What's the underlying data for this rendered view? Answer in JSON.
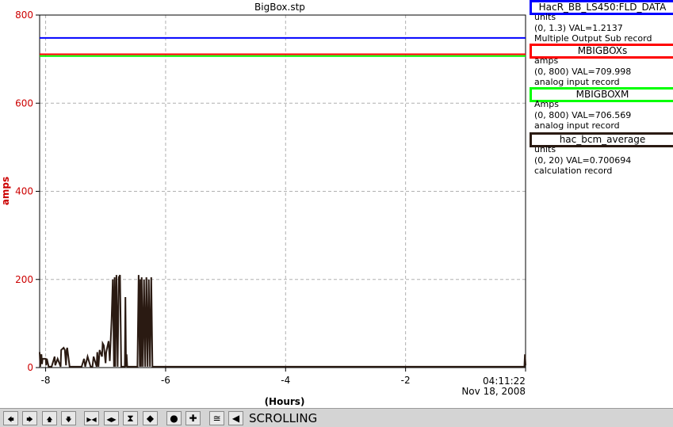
{
  "chart_data": {
    "type": "line",
    "title": "BigBox.stp",
    "xlabel": "(Hours)",
    "ylabel": "amps",
    "xlim": [
      -8.1,
      0
    ],
    "ylim": [
      0,
      800
    ],
    "x_ticks": [
      -8,
      -6,
      -4,
      -2
    ],
    "x_tick_labels": [
      "-8",
      "-6",
      "-4",
      "-2"
    ],
    "y_ticks": [
      0,
      200,
      400,
      600,
      800
    ],
    "y_tick_labels": [
      "0",
      "200",
      "400",
      "600",
      "800"
    ],
    "end_time": "04:11:22",
    "end_date": "Nov 18, 2008",
    "grid": true,
    "series": [
      {
        "name": "HacR_BB_LS450:FLD_DATA",
        "color": "#0000ff",
        "x": [
          -8.1,
          0
        ],
        "y": [
          748,
          748
        ]
      },
      {
        "name": "MBIGBOXs",
        "color": "#ff0000",
        "x": [
          -8.1,
          0
        ],
        "y": [
          711,
          711
        ]
      },
      {
        "name": "MBIGBOXM",
        "color": "#00ff00",
        "x": [
          -8.1,
          0
        ],
        "y": [
          707,
          707
        ]
      },
      {
        "name": "hac_bcm_average",
        "color": "#2a1a12",
        "x": [
          -8.1,
          -8.09,
          -8.08,
          -8.07,
          -8.06,
          -8.05,
          -8.0,
          -7.99,
          -7.98,
          -7.95,
          -7.9,
          -7.85,
          -7.84,
          -7.8,
          -7.75,
          -7.74,
          -7.7,
          -7.68,
          -7.66,
          -7.65,
          -7.64,
          -7.6,
          -7.5,
          -7.4,
          -7.36,
          -7.34,
          -7.3,
          -7.28,
          -7.25,
          -7.22,
          -7.2,
          -7.15,
          -7.14,
          -7.12,
          -7.1,
          -7.06,
          -7.05,
          -7.03,
          -7.0,
          -6.99,
          -6.95,
          -6.93,
          -6.9,
          -6.88,
          -6.86,
          -6.85,
          -6.84,
          -6.82,
          -6.8,
          -6.78,
          -6.76,
          -6.74,
          -6.72,
          -6.7,
          -6.68,
          -6.67,
          -6.66,
          -6.65,
          -6.64,
          -6.6,
          -6.58,
          -6.55,
          -6.52,
          -6.5,
          -6.47,
          -6.45,
          -6.43,
          -6.42,
          -6.41,
          -6.4,
          -6.38,
          -6.36,
          -6.34,
          -6.32,
          -6.3,
          -6.28,
          -6.26,
          -6.24,
          -6.22,
          -6.2,
          -6.18,
          -6.16,
          -6.14,
          -6.12,
          -6.1,
          -6.08,
          -5.0,
          -4.0,
          -3.0,
          -2.0,
          -1.0,
          -0.02,
          -0.01,
          0.0
        ],
        "y": [
          35,
          2,
          25,
          30,
          8,
          20,
          20,
          5,
          20,
          2,
          2,
          25,
          5,
          20,
          2,
          40,
          45,
          40,
          5,
          40,
          45,
          2,
          2,
          2,
          20,
          2,
          25,
          15,
          2,
          2,
          25,
          2,
          35,
          2,
          40,
          25,
          55,
          50,
          10,
          35,
          60,
          15,
          110,
          200,
          2,
          205,
          2,
          210,
          2,
          205,
          210,
          2,
          2,
          2,
          2,
          160,
          2,
          30,
          2,
          2,
          2,
          2,
          2,
          2,
          2,
          210,
          2,
          200,
          2,
          205,
          2,
          200,
          2,
          205,
          2,
          200,
          2,
          205,
          2,
          2,
          2,
          2,
          2,
          2,
          2,
          2,
          2,
          2,
          2,
          2,
          2,
          2,
          30,
          5
        ]
      }
    ]
  },
  "legend": [
    {
      "name": "HacR_BB_LS450:FLD_DATA",
      "color": "#0000ff",
      "units": "units",
      "range_val": "(0, 1.3) VAL=1.2137",
      "record": "Multiple Output Sub record"
    },
    {
      "name": "MBIGBOXs",
      "color": "#ff0000",
      "units": "amps",
      "range_val": "(0, 800) VAL=709.998",
      "record": "analog input record"
    },
    {
      "name": "MBIGBOXM",
      "color": "#00ff00",
      "units": "Amps",
      "range_val": "(0, 800) VAL=706.569",
      "record": "analog input record"
    },
    {
      "name": "hac_bcm_average",
      "color": "#2a1a12",
      "units": "units",
      "range_val": "(0, 20) VAL=0.700694",
      "record": "calculation record"
    }
  ],
  "toolbar": {
    "status": "SCROLLING",
    "buttons": [
      {
        "name": "scroll-left-button",
        "glyph": "🡄"
      },
      {
        "name": "scroll-right-button",
        "glyph": "🡆"
      },
      {
        "name": "scroll-up-button",
        "glyph": "🡅"
      },
      {
        "name": "scroll-down-button",
        "glyph": "🡇"
      },
      {
        "name": "zoom-in-x-button",
        "glyph": "▶◀"
      },
      {
        "name": "zoom-out-x-button",
        "glyph": "◀▶"
      },
      {
        "name": "zoom-in-y-button",
        "glyph": "⧗"
      },
      {
        "name": "zoom-out-y-button",
        "glyph": "◆"
      },
      {
        "name": "stop-button",
        "glyph": "●"
      },
      {
        "name": "add-button",
        "glyph": "✚"
      },
      {
        "name": "config-button",
        "glyph": "≅"
      },
      {
        "name": "back-button",
        "glyph": "◀"
      }
    ]
  }
}
